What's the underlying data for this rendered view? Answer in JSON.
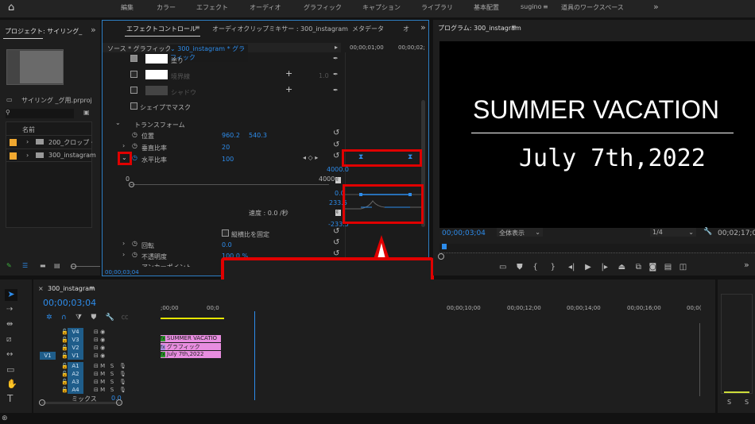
{
  "topbar": {
    "workspaces": [
      "編集",
      "カラー",
      "エフェクト",
      "オーディオ",
      "グラフィック",
      "キャプション",
      "ライブラリ",
      "基本配置",
      "sugino",
      "道具のワークスペース"
    ]
  },
  "project": {
    "title": "プロジェクト: サイリング_",
    "file": "サイリング _グ用.prproj",
    "col_name": "名前",
    "items": [
      {
        "name": "200_クロップ・"
      },
      {
        "name": "300_instagram"
      }
    ]
  },
  "effect_controls": {
    "tabs": [
      "エフェクトコントロール",
      "オーディオクリップミキサー : 300_instagram",
      "メタデータ",
      "オ"
    ],
    "source": "ソース * グラフィック",
    "clip": "300_instagram * グラフィック",
    "ruler": [
      "00;00;01;00",
      "00;00;02;"
    ],
    "fill": "塗り",
    "stroke": "境界線",
    "stroke_val": "1.0",
    "shadow": "シャドウ",
    "mask": "シェイプでマスク",
    "transform": "トランスフォーム",
    "position": {
      "label": "位置",
      "x": "960.2",
      "y": "540.3"
    },
    "vscale": {
      "label": "垂直比率",
      "value": "20"
    },
    "hscale": {
      "label": "水平比率",
      "value": "100"
    },
    "graph": {
      "max": "4000.0",
      "min_label": "0",
      "max_label": "4000",
      "zero": "0.0",
      "vmax": "233.5",
      "vmin": "-233.5",
      "speed": "速度 : 0.0 /秒"
    },
    "lock_ratio": "縦横比を固定",
    "rotation": {
      "label": "回転",
      "value": "0.0"
    },
    "opacity": {
      "label": "不透明度",
      "value": "100.0 %"
    },
    "anchor": {
      "label": "アンカーポイント"
    },
    "timecode": "00;00;03;04"
  },
  "program": {
    "title": "プログラム: 300_instagram",
    "line1": "SUMMER VACATION",
    "line2": "July 7th,2022",
    "timecode": "00;00;03;04",
    "fit": "全体表示",
    "res": "1/4",
    "duration": "00;02;17;0"
  },
  "timeline": {
    "title": "300_instagram",
    "timecode": "00;00;03;04",
    "ruler": [
      ";00;00",
      "00;0",
      "00;00;10;00",
      "00;00;12;00",
      "00;00;14;00",
      "00;00;16;00",
      "00;0("
    ],
    "video_tracks": [
      "V4",
      "V3",
      "V2",
      "V1"
    ],
    "src": "V1",
    "audio_tracks": [
      "A1",
      "A2",
      "A3",
      "A4"
    ],
    "mix": "ミックス",
    "mix_val": "0.0",
    "m": "M",
    "s": "S",
    "clips": [
      "SUMMER VACATIO",
      "グラフィック",
      "July 7th,2022"
    ],
    "fx": "fx"
  },
  "meter": {
    "s": "S"
  }
}
